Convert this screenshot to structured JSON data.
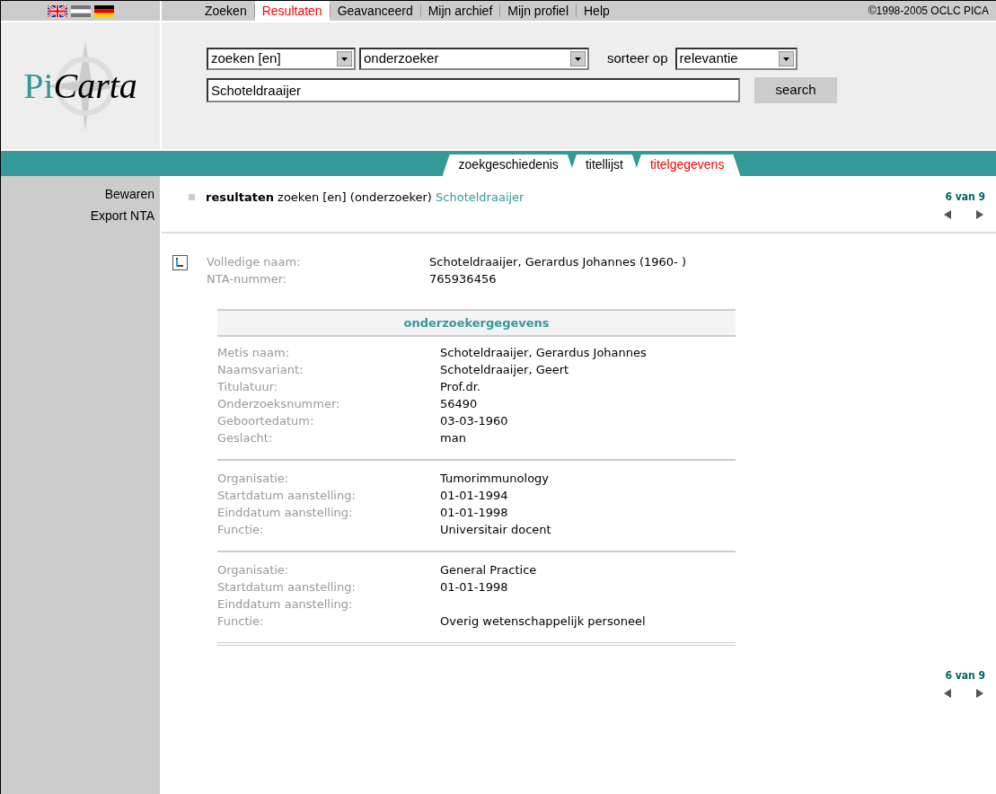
{
  "nav": {
    "items": [
      {
        "label": "Zoeken",
        "selected": false
      },
      {
        "label": "Resultaten",
        "selected": true
      },
      {
        "label": "Geavanceerd",
        "selected": false
      },
      {
        "label": "Mijn archief",
        "selected": false
      },
      {
        "label": "Mijn profiel",
        "selected": false
      },
      {
        "label": "Help",
        "selected": false
      }
    ],
    "copyright": "©1998-2005 OCLC PICA"
  },
  "logo": {
    "part_1": "Pi",
    "part_2": "Carta"
  },
  "search": {
    "mode": "zoeken [en]",
    "field": "onderzoeker",
    "sort_label": "sorteer op",
    "sort": "relevantie",
    "query": "Schoteldraaijer",
    "button": "search"
  },
  "tabs": [
    {
      "label": "zoekgeschiedenis",
      "selected": false
    },
    {
      "label": "titellijst",
      "selected": false
    },
    {
      "label": "titelgegevens",
      "selected": true
    }
  ],
  "sidebar": {
    "items": [
      "Bewaren",
      "Export NTA"
    ]
  },
  "summary": {
    "text": "**resultaten** zoeken [en] (onderzoeker)",
    "term": "Schoteldraaijer"
  },
  "pager_top": {
    "position": "6 van 9"
  },
  "record": {
    "fields": [
      {
        "label": "Volledige naam:",
        "value": "Schoteldraaijer, Gerardus Johannes (1960- )"
      },
      {
        "label": "NTA-nummer:",
        "value": "765936456"
      }
    ],
    "section_title": "onderzoekergegevens",
    "groups": [
      [
        {
          "label": "Metis naam:",
          "value": "Schoteldraaijer, Gerardus Johannes"
        },
        {
          "label": "Naamsvariant:",
          "value": "Schoteldraaijer, Geert"
        },
        {
          "label": "Titulatuur:",
          "value": "Prof.dr."
        },
        {
          "label": "Onderzoeksnummer:",
          "value": "56490"
        },
        {
          "label": "Geboortedatum:",
          "value": "03-03-1960"
        },
        {
          "label": "Geslacht:",
          "value": "man"
        }
      ],
      [
        {
          "label": "Organisatie:",
          "value": "Tumorimmunology"
        },
        {
          "label": "Startdatum aanstelling:",
          "value": "01-01-1994"
        },
        {
          "label": "Einddatum aanstelling:",
          "value": "01-01-1998"
        },
        {
          "label": "Functie:",
          "value": "Universitair docent"
        }
      ],
      [
        {
          "label": "Organisatie:",
          "value": "General Practice"
        },
        {
          "label": "Startdatum aanstelling:",
          "value": "01-01-1998"
        },
        {
          "label": "Einddatum aanstelling:"
        },
        {
          "label": "Functie:",
          "value": "Overig wetenschappelijk personeel"
        }
      ]
    ]
  },
  "pager_bottom": {
    "position": "6 van 9"
  }
}
